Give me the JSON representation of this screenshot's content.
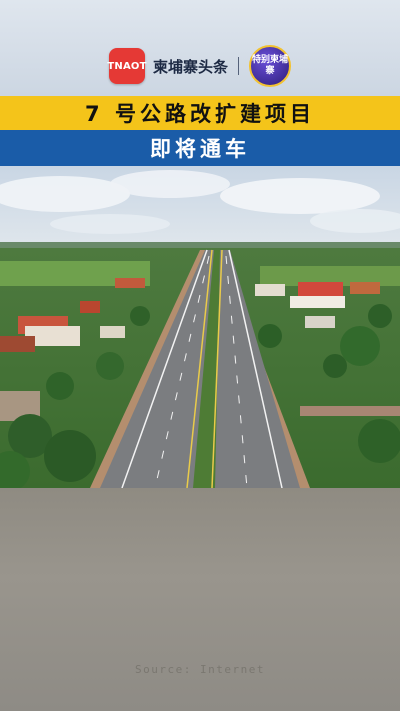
{
  "header": {
    "logo_text": "TNAOT",
    "brand_name": "柬埔寨头条",
    "special_badge": "特别柬埔寨"
  },
  "headline": {
    "title": "7 号公路改扩建项目",
    "subtitle": "即将通车"
  },
  "media": {
    "source_label": "Source: Internet"
  },
  "colors": {
    "title_bar": "#f4c41a",
    "subtitle_bar": "#1a5ca8",
    "logo_red": "#e53935"
  }
}
